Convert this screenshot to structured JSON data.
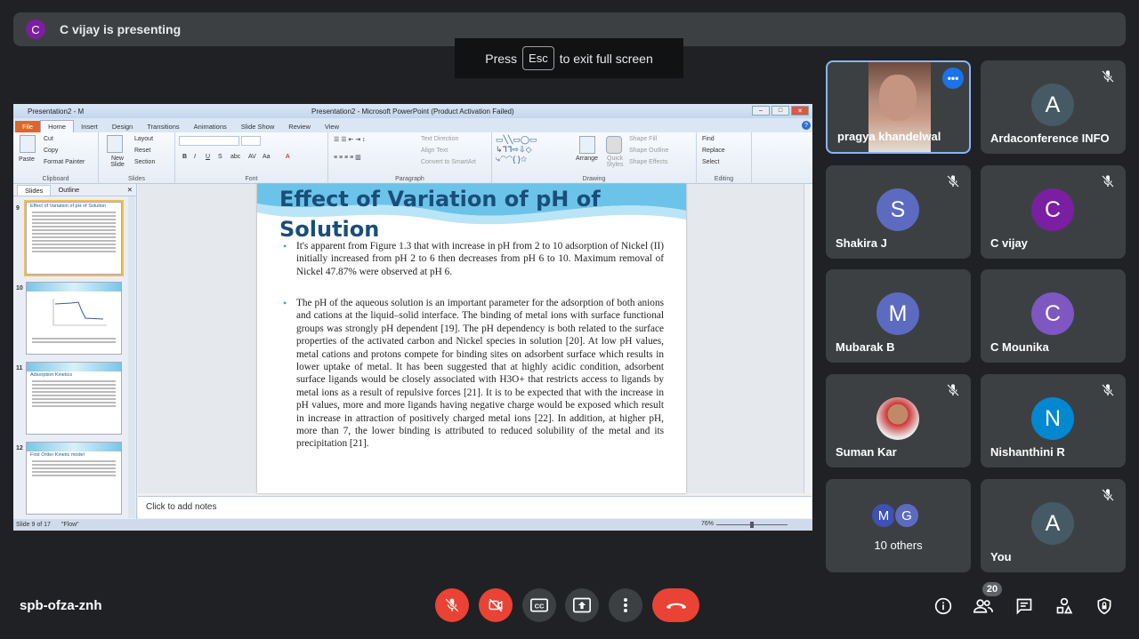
{
  "banner": {
    "avatar_letter": "C",
    "text": "C vijay is presenting"
  },
  "toast": {
    "press": "Press",
    "key": "Esc",
    "rest": "to exit full screen"
  },
  "ppt": {
    "window_title_left": "Presentation2 - M",
    "window_title": "Presentation2 - Microsoft PowerPoint (Product Activation Failed)",
    "tabs": [
      "File",
      "Home",
      "Insert",
      "Design",
      "Transitions",
      "Animations",
      "Slide Show",
      "Review",
      "View"
    ],
    "ribbon": {
      "paste": "Paste",
      "cut": "Cut",
      "copy": "Copy",
      "format_painter": "Format Painter",
      "clipboard": "Clipboard",
      "new_slide": "New Slide",
      "layout": "Layout",
      "reset": "Reset",
      "section": "Section",
      "slides": "Slides",
      "font": "Font",
      "paragraph": "Paragraph",
      "text_direction": "Text Direction",
      "align_text": "Align Text",
      "convert_smartart": "Convert to SmartArt",
      "arrange": "Arrange",
      "quick_styles": "Quick Styles",
      "shape_fill": "Shape Fill",
      "shape_outline": "Shape Outline",
      "shape_effects": "Shape Effects",
      "drawing": "Drawing",
      "find": "Find",
      "replace": "Replace",
      "select": "Select",
      "editing": "Editing"
    },
    "panel_tabs": {
      "slides": "Slides",
      "outline": "Outline"
    },
    "thumbnails": [
      {
        "num": "9",
        "title": "Effect of Variation of pH of Solution"
      },
      {
        "num": "10",
        "title": ""
      },
      {
        "num": "11",
        "title": "Adsorption Kinetics"
      },
      {
        "num": "12",
        "title": "First Order Kinetic model"
      }
    ],
    "slide": {
      "title": "Effect of Variation of pH of Solution",
      "bullet1": "It's apparent from Figure 1.3 that with increase in pH from 2 to 10 adsorption of Nickel (II) initially increased from  pH 2 to 6 then decreases from pH 6 to 10. Maximum removal of Nickel 47.87% were observed at pH 6.",
      "bullet2": "The pH of the aqueous solution is an important parameter for the adsorption of both anions and cations at the liquid–solid interface. The binding of metal ions with surface functional groups was strongly pH dependent [19]. The pH dependency is both related to the surface properties of the activated carbon and Nickel species in solution [20]. At low pH values, metal cations and protons compete for binding sites on adsorbent surface which results in lower uptake of metal. It has been suggested that at highly acidic condition, adsorbent surface ligands would be closely associated with H3O+ that restricts access to ligands by metal ions as a result of repulsive forces [21]. It is to be expected that with the increase in pH values, more and more ligands having negative charge would be exposed which result in increase in attraction of positively charged metal ions [22]. In addition, at higher pH, more than 7, the lower binding is attributed to reduced solubility of the metal and its precipitation [21]."
    },
    "notes_placeholder": "Click to add notes",
    "status": {
      "slide": "Slide 9 of 17",
      "theme": "\"Flow\"",
      "zoom": "76%"
    }
  },
  "participants": [
    {
      "name": "pragya khandelwal",
      "type": "photo",
      "active": true
    },
    {
      "name": "Ardaconference INFO",
      "letter": "A",
      "color": "#455a64",
      "muted": true
    },
    {
      "name": "Shakira J",
      "letter": "S",
      "color": "#5c6bc0",
      "muted": true
    },
    {
      "name": "C vijay",
      "letter": "C",
      "color": "#7b1fa2",
      "muted": true
    },
    {
      "name": "Mubarak B",
      "letter": "M",
      "color": "#5c6bc0",
      "muted": false
    },
    {
      "name": "C Mounika",
      "letter": "C",
      "color": "#7e57c2",
      "muted": false
    },
    {
      "name": "Suman Kar",
      "type": "photo2",
      "muted": true
    },
    {
      "name": "Nishanthini R",
      "letter": "N",
      "color": "#0288d1",
      "muted": true
    },
    {
      "name": "10 others",
      "type": "others",
      "letters": [
        "M",
        "G"
      ]
    },
    {
      "name": "You",
      "letter": "A",
      "color": "#455a64",
      "muted": true
    }
  ],
  "bottom": {
    "meeting_code": "spb-ofza-znh",
    "participant_count": "20"
  },
  "colors": {
    "accent": "#8ab4f8",
    "danger": "#ea4335",
    "tile": "#3c4043"
  }
}
